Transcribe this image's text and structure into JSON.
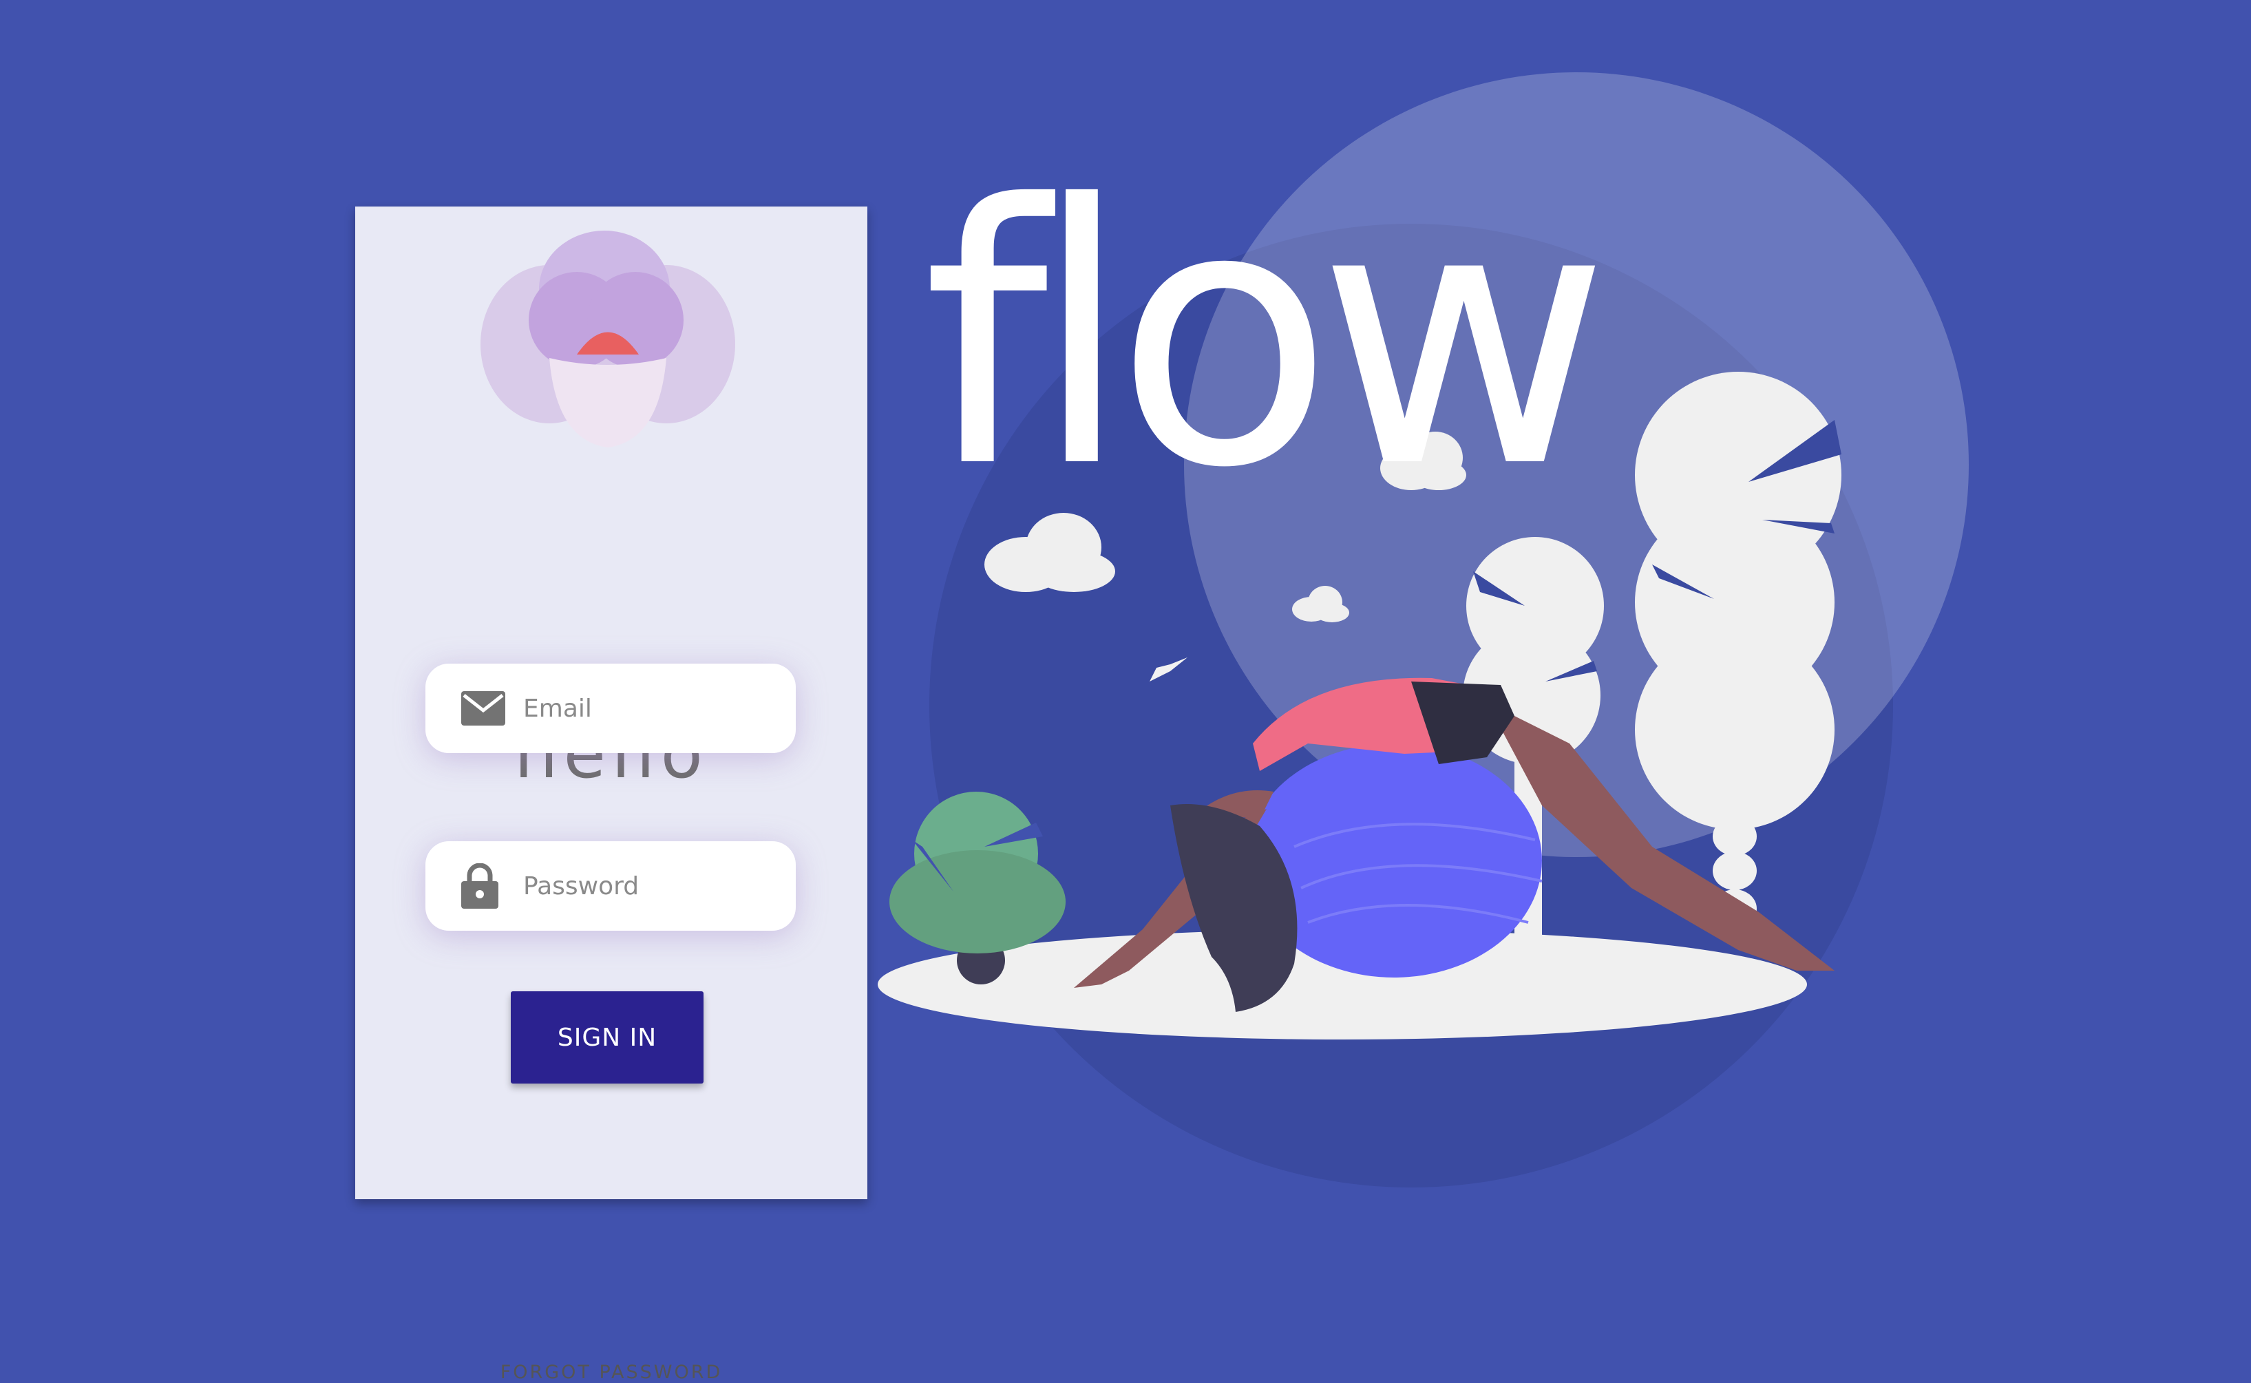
{
  "app": {
    "title": "flow"
  },
  "login": {
    "greeting": "hello",
    "email_placeholder": "Email",
    "password_placeholder": "Password",
    "signin_label": "SIGN IN",
    "forgot_label": "FORGOT PASSWORD"
  },
  "icons": {
    "logo": "lotus-flower-icon",
    "email": "envelope-icon",
    "password": "padlock-icon"
  },
  "colors": {
    "background": "#4152AE",
    "panel": "#E8E9F5",
    "button": "#2B2290",
    "ball": "#6464F8",
    "shirt": "#EF6C86",
    "bush": "#6BAE8D"
  }
}
